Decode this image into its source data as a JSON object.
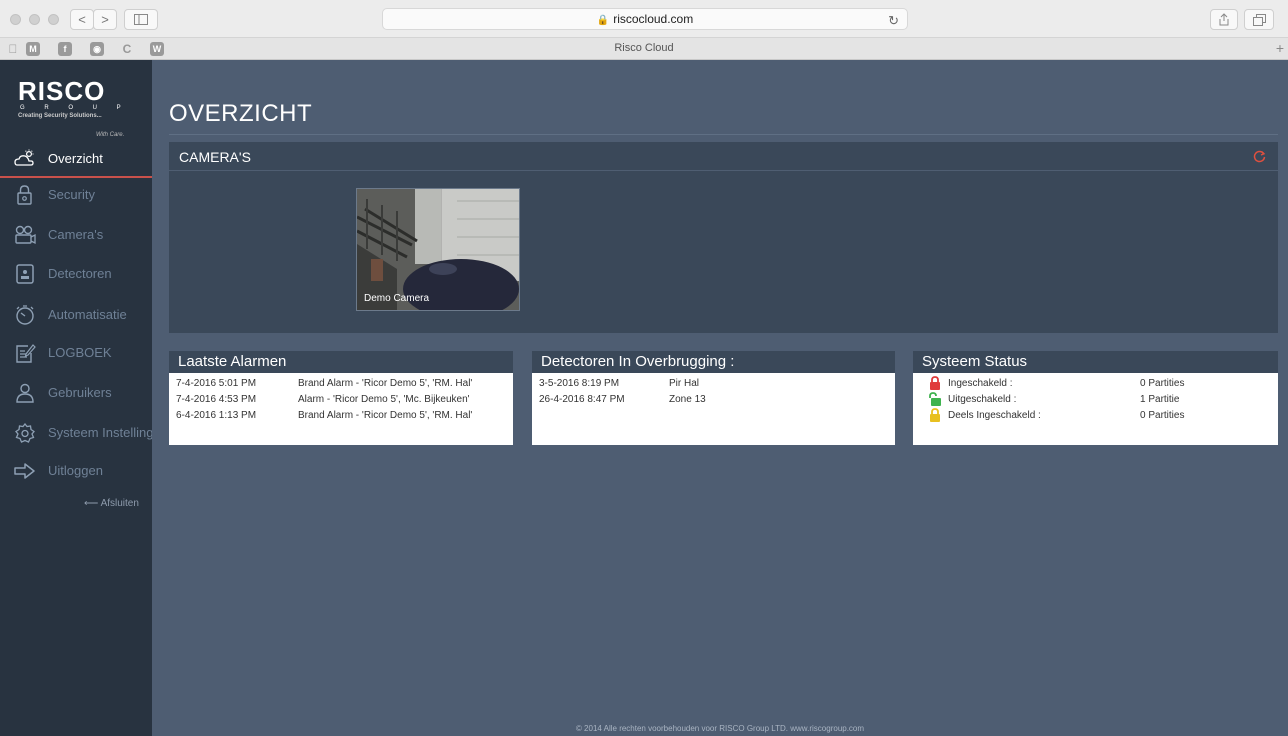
{
  "browser": {
    "url": "riscocloud.com",
    "tab_title": "Risco Cloud",
    "nav_back": "<",
    "nav_forward": ">",
    "favorites": [
      "M",
      "W"
    ]
  },
  "logo": {
    "brand": "RISCO",
    "group": "G R O U P",
    "tagline": "Creating Security Solutions...",
    "care": "With Care."
  },
  "sidebar": {
    "items": [
      {
        "label": "Overzicht",
        "icon": "weather-icon",
        "active": true
      },
      {
        "label": "Security",
        "icon": "lock-icon"
      },
      {
        "label": "Camera's",
        "icon": "camera-icon"
      },
      {
        "label": "Detectoren",
        "icon": "detector-icon"
      },
      {
        "label": "Automatisatie",
        "icon": "timer-icon"
      },
      {
        "label": "LOGBOEK",
        "icon": "logbook-icon"
      },
      {
        "label": "Gebruikers",
        "icon": "user-icon"
      },
      {
        "label": "Systeem Instellingen",
        "icon": "settings-icon"
      },
      {
        "label": "Uitloggen",
        "icon": "logout-icon"
      }
    ],
    "close_label": "⟵ Afsluiten"
  },
  "page_title": "OVERZICHT",
  "cameras": {
    "header": "CAMERA'S",
    "items": [
      {
        "label": "Demo Camera"
      }
    ]
  },
  "alarms": {
    "header": "Laatste Alarmen",
    "rows": [
      {
        "time": "7-4-2016  5:01 PM",
        "text": "Brand Alarm - 'Ricor Demo 5', 'RM. Hal'"
      },
      {
        "time": "7-4-2016  4:53 PM",
        "text": "Alarm - 'Ricor Demo 5', 'Mc. Bijkeuken'"
      },
      {
        "time": "6-4-2016  1:13 PM",
        "text": "Brand Alarm - 'Ricor Demo 5', 'RM. Hal'"
      }
    ]
  },
  "bypass": {
    "header": "Detectoren In Overbrugging :",
    "rows": [
      {
        "time": "3-5-2016  8:19 PM",
        "zone": "Pir Hal"
      },
      {
        "time": "26-4-2016  8:47 PM",
        "zone": "Zone 13"
      }
    ]
  },
  "status": {
    "header": "Systeem Status",
    "rows": [
      {
        "label": "Ingeschakeld :",
        "value": "0 Partities",
        "color": "#e03b3b"
      },
      {
        "label": "Uitgeschakeld :",
        "value": "1 Partitie",
        "color": "#3fb34f"
      },
      {
        "label": "Deels Ingeschakeld :",
        "value": "0 Partities",
        "color": "#e8c020"
      }
    ]
  },
  "footer": "© 2014 Alle rechten voorbehouden voor RISCO Group LTD. www.riscogroup.com",
  "colors": {
    "accent": "#c9514b",
    "sidebar_bg": "#283340",
    "panel_bg": "#3a4859",
    "page_bg": "#4e5d72"
  }
}
